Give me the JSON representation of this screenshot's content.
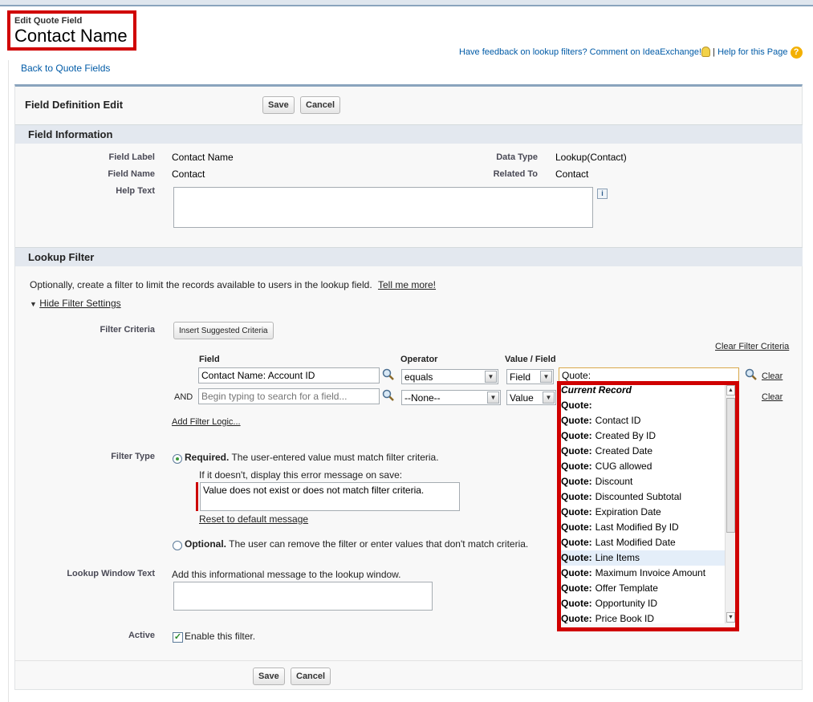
{
  "header": {
    "subtitle": "Edit Quote Field",
    "title": "Contact Name",
    "back_link": "Back to Quote Fields",
    "feedback_link": "Have feedback on lookup filters? Comment on IdeaExchange!",
    "separator": "|",
    "help_link": "Help for this Page",
    "help_icon_glyph": "?"
  },
  "panel": {
    "title": "Field Definition Edit",
    "save_label": "Save",
    "cancel_label": "Cancel"
  },
  "field_info": {
    "section_title": "Field Information",
    "field_label_lbl": "Field Label",
    "field_label_val": "Contact Name",
    "field_name_lbl": "Field Name",
    "field_name_val": "Contact",
    "help_text_lbl": "Help Text",
    "data_type_lbl": "Data Type",
    "data_type_val": "Lookup(Contact)",
    "related_to_lbl": "Related To",
    "related_to_val": "Contact",
    "info_icon_glyph": "i"
  },
  "lookup_filter": {
    "section_title": "Lookup Filter",
    "intro": "Optionally, create a filter to limit the records available to users in the lookup field.",
    "tell_me_more": "Tell me more!",
    "hide_settings": "Hide Filter Settings",
    "filter_criteria_lbl": "Filter Criteria",
    "insert_suggested": "Insert Suggested Criteria",
    "clear_filter_criteria": "Clear Filter Criteria",
    "col_field": "Field",
    "col_operator": "Operator",
    "col_value": "Value / Field",
    "row1": {
      "field": "Contact Name: Account ID",
      "operator": "equals",
      "value_type": "Field",
      "value": "Quote:",
      "clear": "Clear"
    },
    "row2": {
      "prefix": "AND",
      "field_placeholder": "Begin typing to search for a field...",
      "operator": "--None--",
      "value_type": "Value",
      "clear": "Clear"
    },
    "add_filter_logic": "Add Filter Logic...",
    "filter_type_lbl": "Filter Type",
    "required_bold": "Required.",
    "required_text": "The user-entered value must match filter criteria.",
    "error_prompt": "If it doesn't, display this error message on save:",
    "error_message": "Value does not exist or does not match filter criteria.",
    "reset_default": "Reset to default message",
    "optional_bold": "Optional.",
    "optional_text": "The user can remove the filter or enter values that don't match criteria.",
    "lookup_window_lbl": "Lookup Window Text",
    "lookup_window_hint": "Add this informational message to the lookup window.",
    "active_lbl": "Active",
    "enable_filter": "Enable this filter."
  },
  "dropdown": {
    "header": "Current Record",
    "items": [
      {
        "prefix": "Quote:",
        "label": ""
      },
      {
        "prefix": "Quote:",
        "label": "Contact ID"
      },
      {
        "prefix": "Quote:",
        "label": "Created By ID"
      },
      {
        "prefix": "Quote:",
        "label": "Created Date"
      },
      {
        "prefix": "Quote:",
        "label": "CUG allowed"
      },
      {
        "prefix": "Quote:",
        "label": "Discount"
      },
      {
        "prefix": "Quote:",
        "label": "Discounted Subtotal"
      },
      {
        "prefix": "Quote:",
        "label": "Expiration Date"
      },
      {
        "prefix": "Quote:",
        "label": "Last Modified By ID"
      },
      {
        "prefix": "Quote:",
        "label": "Last Modified Date"
      },
      {
        "prefix": "Quote:",
        "label": "Line Items"
      },
      {
        "prefix": "Quote:",
        "label": "Maximum Invoice Amount"
      },
      {
        "prefix": "Quote:",
        "label": "Offer Template"
      },
      {
        "prefix": "Quote:",
        "label": "Opportunity ID"
      },
      {
        "prefix": "Quote:",
        "label": "Price Book ID"
      }
    ],
    "highlighted_index": 10
  },
  "footer": {
    "save_label": "Save",
    "cancel_label": "Cancel"
  },
  "colors": {
    "highlight_border": "#d00000",
    "link": "#015ba7",
    "section_bar": "#e3e8ef"
  }
}
